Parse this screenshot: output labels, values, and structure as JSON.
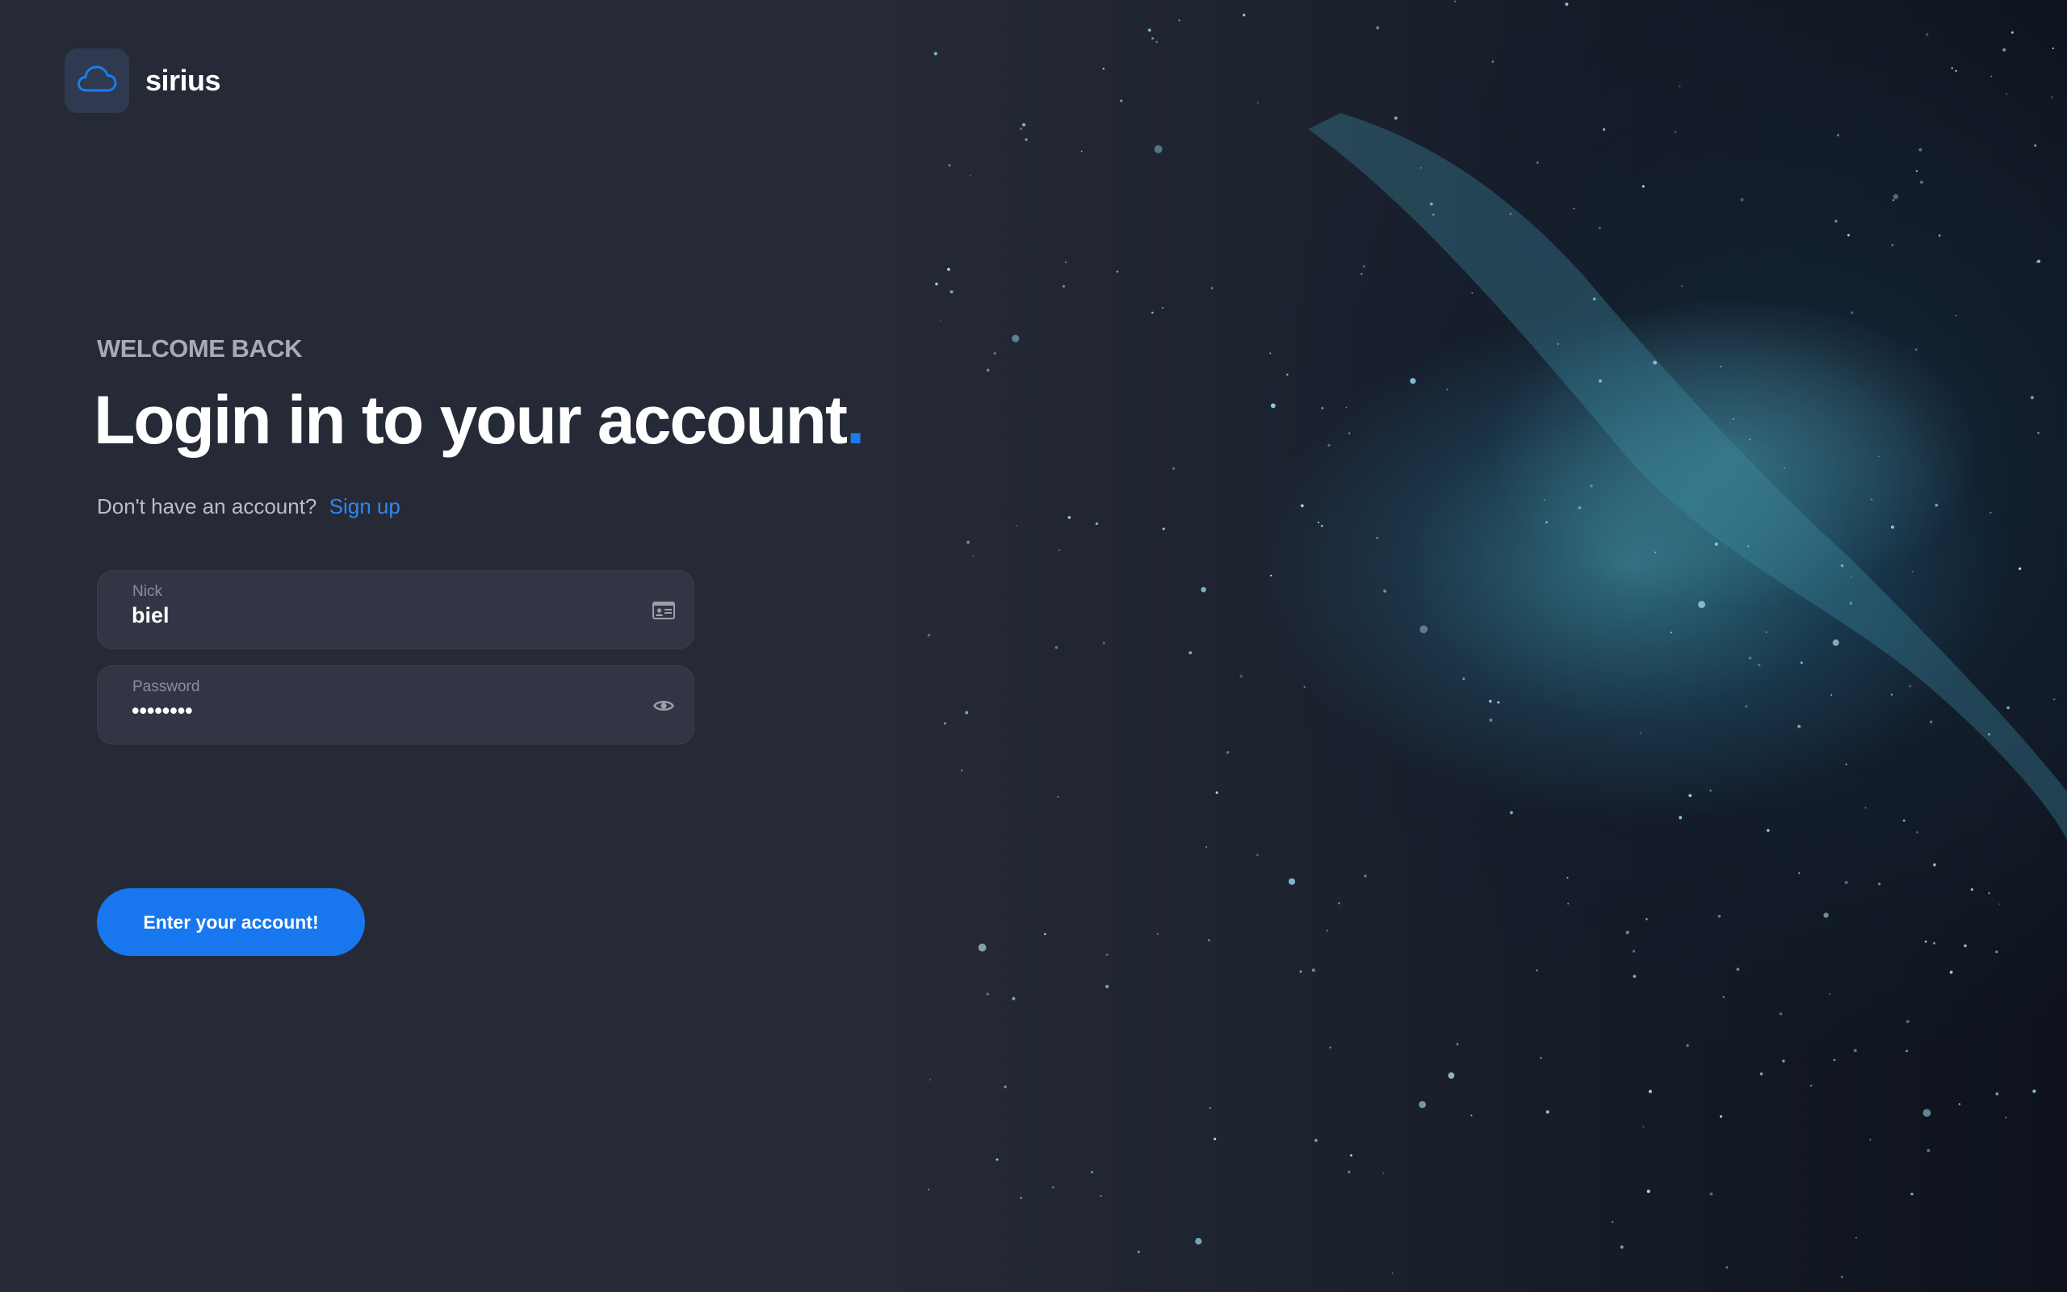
{
  "brand": {
    "name": "sirius",
    "logo_icon": "cloud-icon",
    "accent": "#1d7bf0"
  },
  "login": {
    "eyebrow": "WELCOME BACK",
    "heading": "Login in to your account",
    "heading_dot": ".",
    "signup_prompt": "Don't have an account?",
    "signup_link": "Sign up",
    "nick": {
      "label": "Nick",
      "value": "biel",
      "icon": "id-card-icon"
    },
    "password": {
      "label": "Password",
      "value": "••••••••",
      "icon": "eye-icon"
    },
    "submit_label": "Enter your account!"
  },
  "background": {
    "type": "space-nebula",
    "colors": [
      "#262a36",
      "#0d121c",
      "#46aabe"
    ]
  }
}
